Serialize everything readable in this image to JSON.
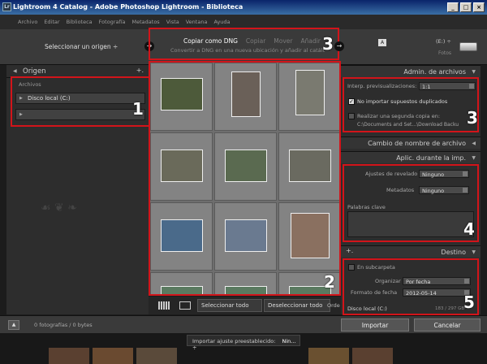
{
  "window": {
    "title": "Lightroom 4 Catalog - Adobe Photoshop Lightroom - Biblioteca",
    "app_icon_label": "Lr",
    "minimize": "_",
    "maximize": "□",
    "close": "×"
  },
  "menu": [
    "Archivo",
    "Editar",
    "Biblioteca",
    "Fotografía",
    "Metadatos",
    "Vista",
    "Ventana",
    "Ayuda"
  ],
  "top": {
    "source_select": "Seleccionar un origen ÷",
    "modes": [
      {
        "label": "Copiar como DNG",
        "active": true
      },
      {
        "label": "Copiar",
        "active": false
      },
      {
        "label": "Mover",
        "active": false
      },
      {
        "label": "Añadir",
        "active": false
      }
    ],
    "mode_description": "Convertir a DNG en una nueva ubicación y añadir al catálogo",
    "dest_badge": "A",
    "dest_drive": "(E:) ÷",
    "dest_photos": "Fotos"
  },
  "left": {
    "header": "Origen",
    "plus": "+.",
    "section_label": "Archivos",
    "disk": "Disco local (C:)",
    "disk2": ""
  },
  "numbers": {
    "n1": "1",
    "n2": "2",
    "n3": "3",
    "n3b": "3",
    "n4": "4",
    "n5": "5"
  },
  "toolbar": {
    "select_all": "Seleccionar todo",
    "deselect_all": "Deseleccionar todo",
    "order": "Orde"
  },
  "right": {
    "file_handling": "Admin. de archivos",
    "preview_label": "Interp. previsualizaciones:",
    "preview_value": "1:1",
    "no_duplicates": "No importar supuestos duplicados",
    "second_copy": "Realizar una segunda copia en:",
    "second_copy_path": "C:\\Documents and Set...\\Download Backu",
    "rename": "Cambio de nombre de archivo",
    "apply": "Aplic. durante la imp.",
    "develop_label": "Ajustes de revelado",
    "develop_value": "Ninguno",
    "metadata_label": "Metadatos",
    "metadata_value": "Ninguno",
    "keywords_label": "Palabras clave",
    "destination": "Destino",
    "plus": "+.",
    "subfolder": "En subcarpeta",
    "organize_label": "Organizar",
    "organize_value": "Por fecha",
    "date_format_label": "Formato de fecha",
    "date_format_value": "2012-05-14",
    "disk": "Disco local (C:)",
    "disk_space": "183 / 297 GB"
  },
  "status": {
    "expand": "▲",
    "count": "0 fotografías / 0 bytes",
    "import": "Importar",
    "cancel": "Cancelar",
    "preset_label": "Importar ajuste preestablecido:",
    "preset_value": "Nin... ÷"
  }
}
